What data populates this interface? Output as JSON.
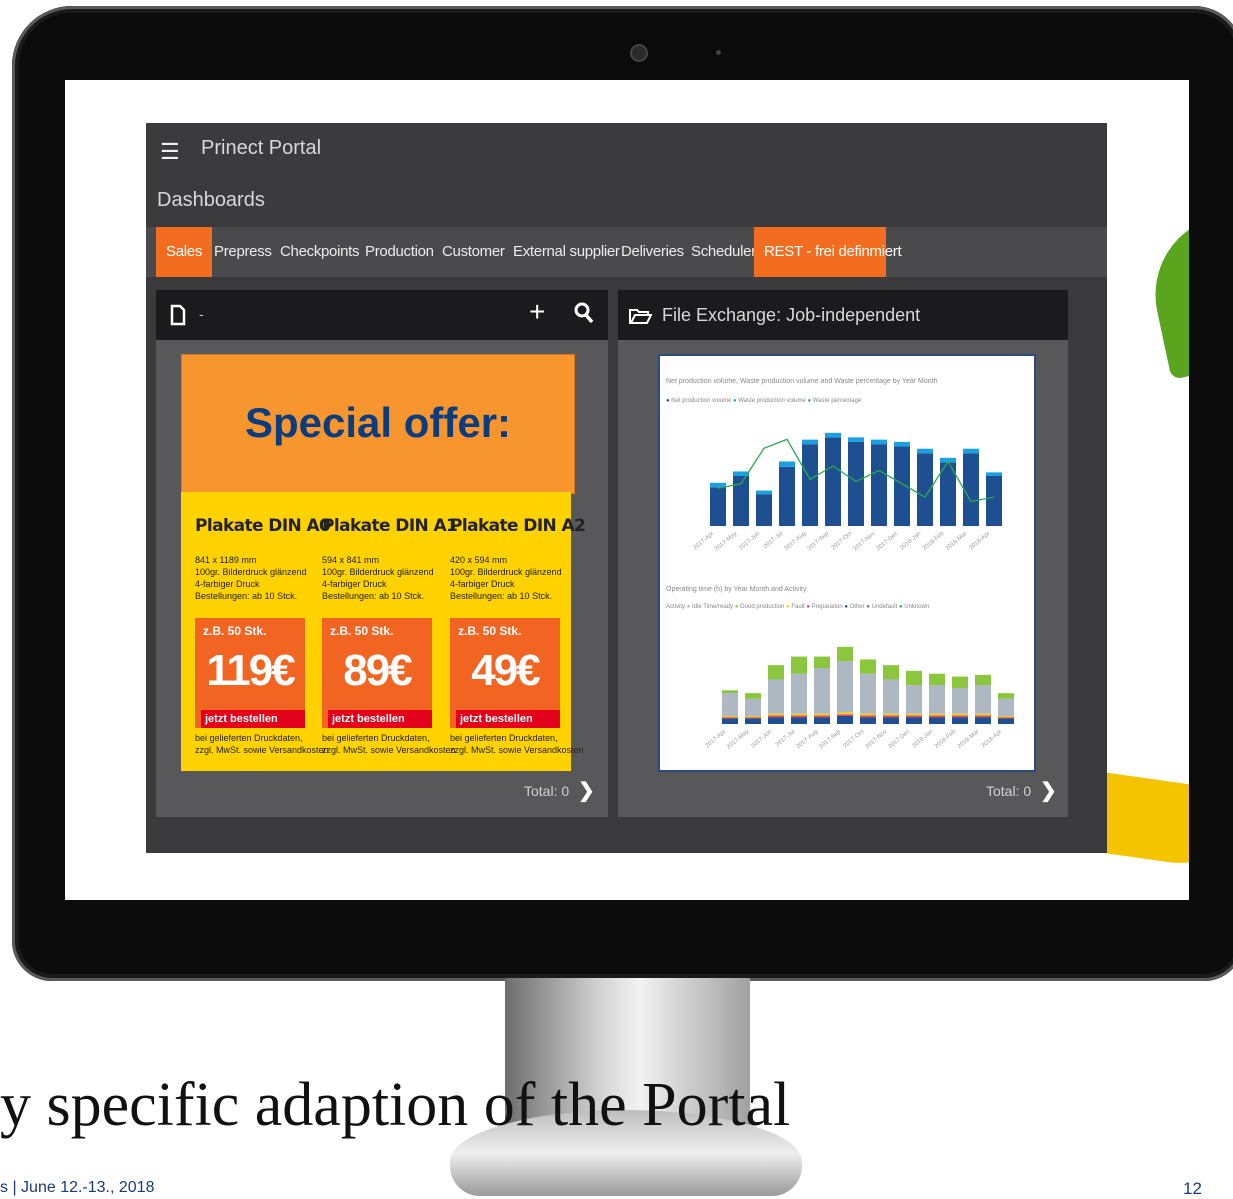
{
  "header": {
    "app_title": "Prinect Portal",
    "section_title": "Dashboards"
  },
  "tabs": [
    {
      "label": "Sales",
      "active": true
    },
    {
      "label": "Prepress",
      "active": false
    },
    {
      "label": "Checkpoints",
      "active": false
    },
    {
      "label": "Production",
      "active": false
    },
    {
      "label": "Customer",
      "active": false
    },
    {
      "label": "External supplier",
      "active": false
    },
    {
      "label": "Deliveries",
      "active": false
    },
    {
      "label": "Scheduler",
      "active": false
    },
    {
      "label": "REST - frei definmiert",
      "active": true
    }
  ],
  "left_panel": {
    "title": "-",
    "offer_text": "Special offer:",
    "total_label": "Total: 0",
    "posters": [
      {
        "name": "Plakate DIN A0",
        "specs": "841 x 1189 mm\n100gr. Bilderdruck glänzend\n4-farbiger Druck\nBestellungen: ab 10 Stck.",
        "qty": "z.B. 50 Stk.",
        "price": "119€",
        "order": "jetzt bestellen",
        "note": "bei gelieferten Druckdaten,\nzzgl. MwSt. sowie Versandkosten"
      },
      {
        "name": "Plakate DIN A1",
        "specs": "594 x 841 mm\n100gr. Bilderdruck glänzend\n4-farbiger Druck\nBestellungen: ab 10 Stck.",
        "qty": "z.B. 50 Stk.",
        "price": "89€",
        "order": "jetzt bestellen",
        "note": "bei gelieferten Druckdaten,\nzzgl. MwSt. sowie Versandkosten"
      },
      {
        "name": "Plakate DIN A2",
        "specs": "420 x 594 mm\n100gr. Bilderdruck glänzend\n4-farbiger Druck\nBestellungen: ab 10 Stck.",
        "qty": "z.B. 50 Stk.",
        "price": "49€",
        "order": "jetzt bestellen",
        "note": "bei gelieferten Druckdaten,\nzzgl. MwSt. sowie Versandkosten"
      }
    ]
  },
  "right_panel": {
    "title": "File Exchange: Job-independent",
    "total_label": "Total: 0",
    "chart1_title": "Net production volume, Waste production volume and Waste percentage by Year Month",
    "chart1_legend": [
      "Net production volume",
      "Waste production volume",
      "Waste percentage"
    ],
    "chart2_title": "Operating time (h) by Year Month and Activity",
    "chart2_legend_label": "Activity",
    "chart2_legend": [
      "Idle Time/ready",
      "Good production",
      "Fault",
      "Preparation",
      "Other",
      "Undefault",
      "Unknown"
    ]
  },
  "chart_data": [
    {
      "type": "bar",
      "title": "Net production volume, Waste production volume and Waste percentage by Year Month",
      "categories": [
        "2017-Apr",
        "2017-May",
        "2017-Jun",
        "2017-Jul",
        "2017-Aug",
        "2017-Sep",
        "2017-Oct",
        "2017-Nov",
        "2017-Dec",
        "2018-Jan",
        "2018-Feb",
        "2018-Mar",
        "2018-Apr"
      ],
      "series": [
        {
          "name": "Net production volume",
          "values": [
            0.85,
            1.1,
            0.7,
            1.3,
            1.8,
            1.95,
            1.85,
            1.8,
            1.75,
            1.6,
            1.4,
            1.6,
            1.1
          ]
        },
        {
          "name": "Waste production volume",
          "values": [
            0.1,
            0.1,
            0.08,
            0.12,
            0.1,
            0.1,
            0.1,
            0.1,
            0.1,
            0.1,
            0.1,
            0.1,
            0.08
          ]
        },
        {
          "name": "Waste percentage",
          "values": [
            10.2,
            10.4,
            12.0,
            12.4,
            10.6,
            11.2,
            10.5,
            11.0,
            10.4,
            9.8,
            11.4,
            9.6,
            9.8
          ]
        }
      ],
      "colors": {
        "net": "#1d4f91",
        "waste": "#1ba1e2",
        "pct": "#2fa84f"
      }
    },
    {
      "type": "bar",
      "title": "Operating time (h) by Year Month and Activity",
      "categories": [
        "2017-Apr",
        "2017-May",
        "2017-Jun",
        "2017-Jul",
        "2017-Aug",
        "2017-Sep",
        "2017-Oct",
        "2017-Nov",
        "2017-Dec",
        "2018-Jan",
        "2018-Feb",
        "2018-Mar",
        "2018-Apr"
      ],
      "series": [
        {
          "name": "Idle Time/ready",
          "values": [
            40,
            30,
            60,
            70,
            80,
            90,
            70,
            60,
            50,
            50,
            45,
            50,
            30
          ]
        },
        {
          "name": "Good production",
          "values": [
            5,
            10,
            25,
            30,
            20,
            25,
            25,
            25,
            25,
            20,
            20,
            18,
            10
          ]
        },
        {
          "name": "Fault",
          "values": [
            2,
            2,
            3,
            3,
            3,
            3,
            3,
            3,
            3,
            3,
            3,
            3,
            2
          ]
        },
        {
          "name": "Preparation",
          "values": [
            2,
            2,
            3,
            3,
            3,
            3,
            3,
            3,
            3,
            3,
            3,
            3,
            2
          ]
        },
        {
          "name": "Other",
          "values": [
            10,
            10,
            12,
            12,
            12,
            14,
            12,
            12,
            12,
            12,
            12,
            12,
            10
          ]
        }
      ],
      "colors": {
        "idle": "#aeb8c2",
        "good": "#8cc63f",
        "fault": "#f2d600",
        "prep": "#e5466b",
        "other": "#1d4f91",
        "undef": "#7b5ea7",
        "unknown": "#2fa84f"
      }
    }
  ],
  "slide": {
    "title": "y specific adaption of the Portal",
    "footer": "s | June 12.-13., 2018",
    "page_number": "12"
  }
}
